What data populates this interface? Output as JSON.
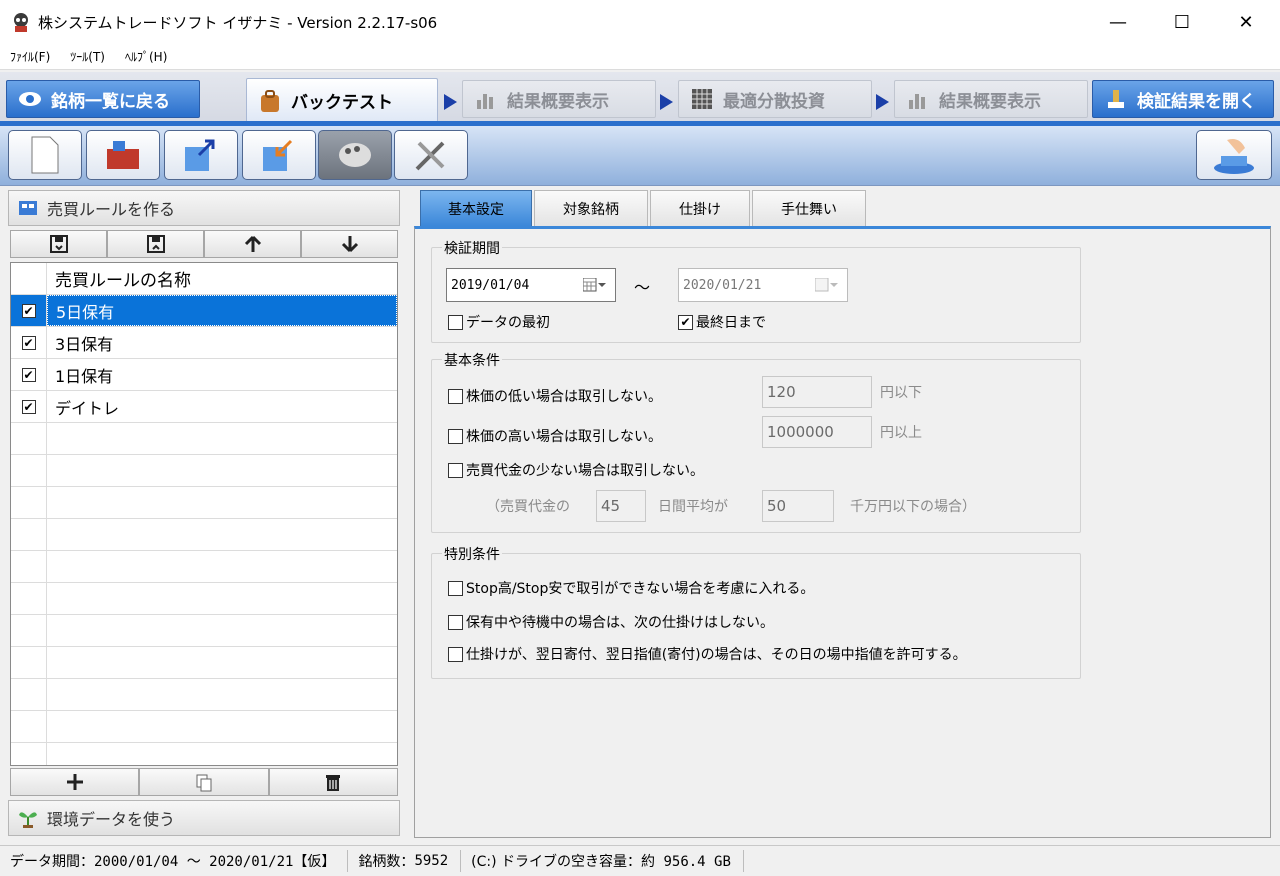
{
  "window": {
    "title": "株システムトレードソフト イザナミ - Version 2.2.17-s06",
    "minimize": "—",
    "maximize": "☐",
    "close": "✕"
  },
  "menu": [
    "ﾌｧｲﾙ(F)",
    "ﾂｰﾙ(T)",
    "ﾍﾙﾌﾟ(H)"
  ],
  "nav_tabs": {
    "back": "銘柄一覧に戻る",
    "backtest": "バックテスト",
    "summary1": "結果概要表示",
    "optimal": "最適分散投資",
    "summary2": "結果概要表示",
    "open_results": "検証結果を開く"
  },
  "left_panel": {
    "header": "売買ルールを作る",
    "column_header": "売買ルールの名称",
    "rules": [
      {
        "name": "5日保有",
        "checked": true,
        "selected": true
      },
      {
        "name": "3日保有",
        "checked": true,
        "selected": false
      },
      {
        "name": "1日保有",
        "checked": true,
        "selected": false
      },
      {
        "name": "デイトレ",
        "checked": true,
        "selected": false
      }
    ],
    "footer": "環境データを使う"
  },
  "tabs": [
    "基本設定",
    "対象銘柄",
    "仕掛け",
    "手仕舞い"
  ],
  "period": {
    "label": "検証期間",
    "start_date": "2019/01/04",
    "tilde": "～",
    "end_date": "2020/01/21",
    "from_first_label": "データの最初",
    "from_first_checked": false,
    "to_last_label": "最終日まで",
    "to_last_checked": true
  },
  "basic": {
    "label": "基本条件",
    "low_price_label": "株価の低い場合は取引しない。",
    "low_price_value": "120",
    "low_price_unit": "円以下",
    "high_price_label": "株価の高い場合は取引しない。",
    "high_price_value": "1000000",
    "high_price_unit": "円以上",
    "low_volume_label": "売買代金の少ない場合は取引しない。",
    "vol_prefix": "（売買代金の",
    "vol_days": "45",
    "vol_mid": "日間平均が",
    "vol_amount": "50",
    "vol_suffix": "千万円以下の場合）"
  },
  "special": {
    "label": "特別条件",
    "opt1": "Stop高/Stop安で取引ができない場合を考慮に入れる。",
    "opt2": "保有中や待機中の場合は、次の仕掛けはしない。",
    "opt3": "仕掛けが、翌日寄付、翌日指値(寄付)の場合は、その日の場中指値を許可する。"
  },
  "status": {
    "period_label": "データ期間：",
    "period_value": "2000/01/04 ～ 2020/01/21【仮】",
    "count_label": "銘柄数：",
    "count_value": "5952",
    "drive_label": "(C:) ドライブの空き容量：",
    "drive_value": "約 956.4 GB"
  },
  "colors": {
    "accent": "#2a6fcc",
    "selected_row": "#0a73d9",
    "tab_active": "#3b87d9"
  }
}
